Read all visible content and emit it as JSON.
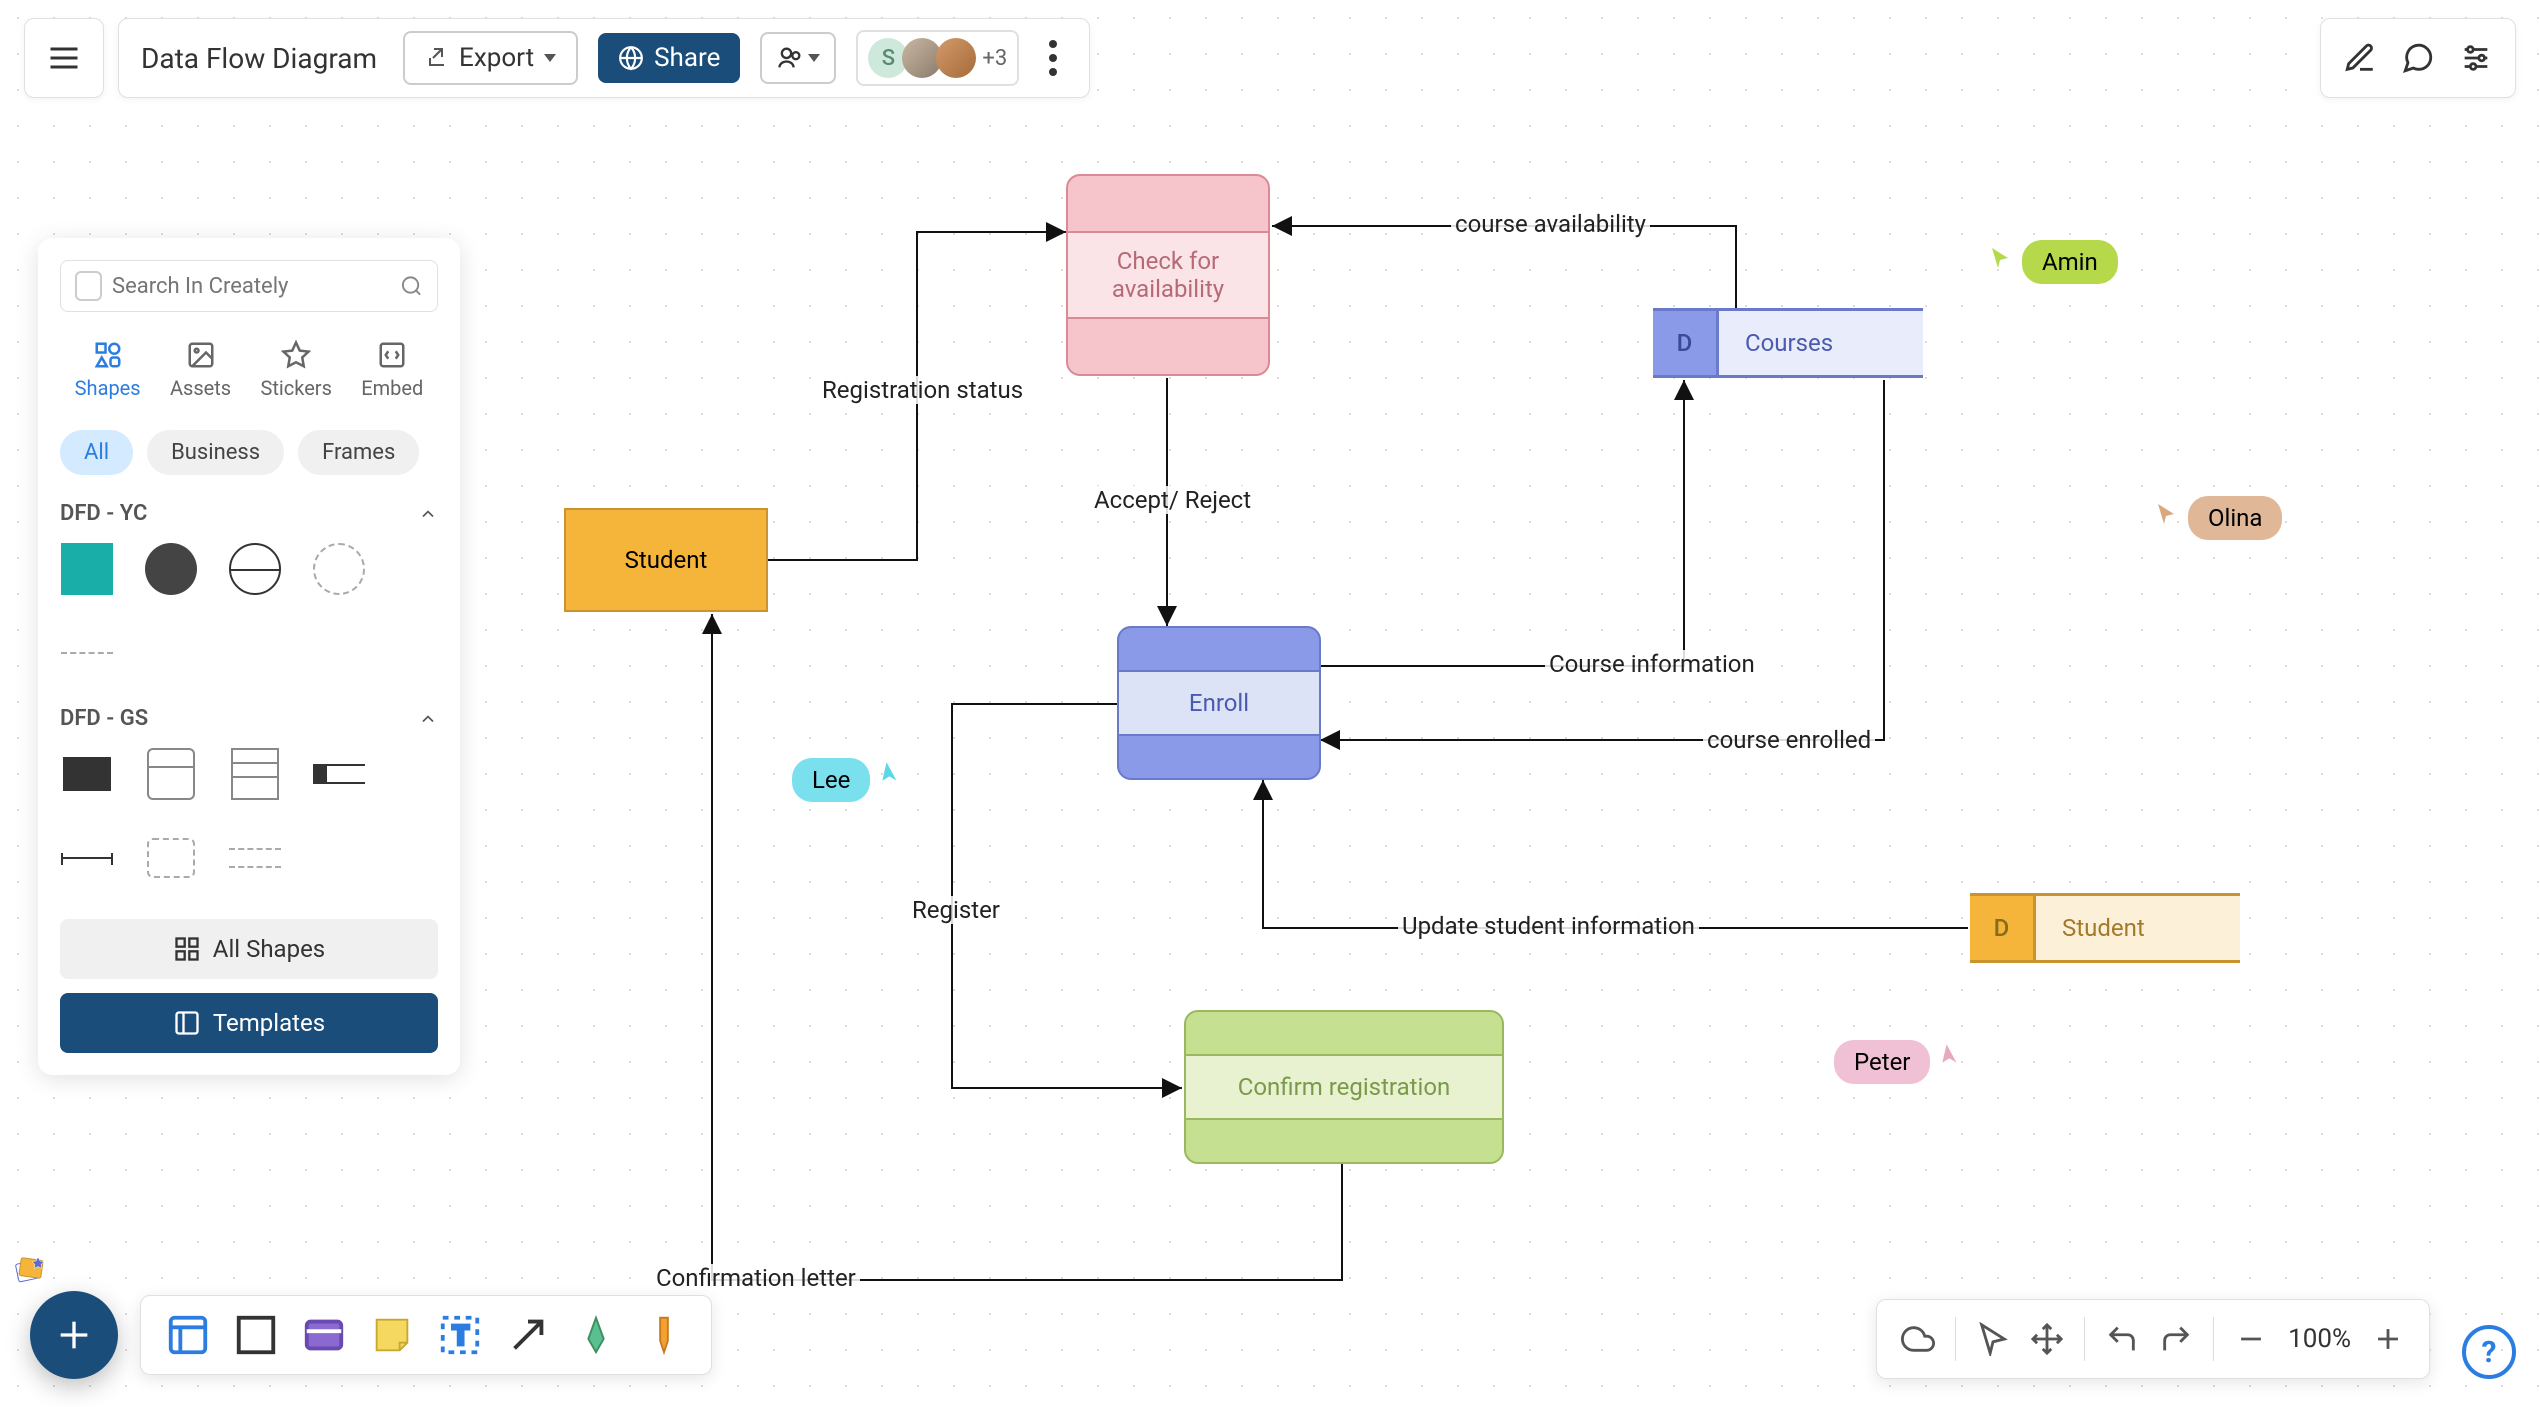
{
  "header": {
    "title": "Data Flow Diagram",
    "export_label": "Export",
    "share_label": "Share",
    "avatar_initial": "S",
    "avatar_more": "+3"
  },
  "panel": {
    "search_placeholder": "Search In Creately",
    "tabs": {
      "shapes": "Shapes",
      "assets": "Assets",
      "stickers": "Stickers",
      "embed": "Embed"
    },
    "chips": {
      "all": "All",
      "business": "Business",
      "frames": "Frames"
    },
    "section_yc": "DFD - YC",
    "section_gs": "DFD - GS",
    "all_shapes": "All Shapes",
    "templates": "Templates"
  },
  "zoom": {
    "level": "100%"
  },
  "diagram": {
    "nodes": {
      "check": {
        "label": "Check for availability"
      },
      "student_entity": {
        "label": "Student"
      },
      "enroll": {
        "label": "Enroll"
      },
      "confirm": {
        "label": "Confirm registration"
      },
      "courses_ds": {
        "code": "D",
        "name": "Courses"
      },
      "student_ds": {
        "code": "D",
        "name": "Student"
      }
    },
    "edges": {
      "reg_status": "Registration status",
      "accept_reject": "Accept/ Reject",
      "course_avail": "course availability",
      "course_info": "Course information",
      "course_enrolled": "course enrolled",
      "register": "Register",
      "update_student": "Update student information",
      "confirmation": "Confirmation letter"
    },
    "cursors": {
      "amin": "Amin",
      "olina": "Olina",
      "lee": "Lee",
      "peter": "Peter"
    }
  }
}
